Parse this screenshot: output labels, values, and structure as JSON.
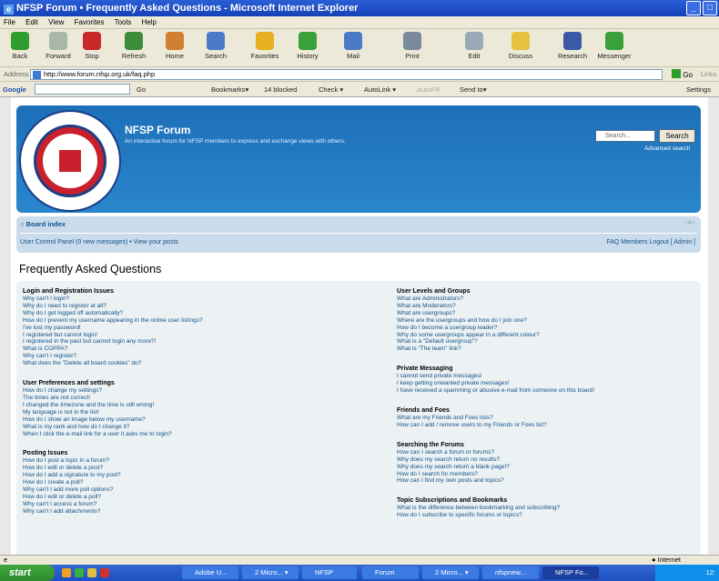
{
  "window": {
    "title": "NFSP Forum • Frequently Asked Questions - Microsoft Internet Explorer"
  },
  "menu": [
    "File",
    "Edit",
    "View",
    "Favorites",
    "Tools",
    "Help"
  ],
  "toolbar": {
    "buttons": [
      {
        "label": "Back",
        "icon": "back-arrow-icon",
        "color": "#2f9d2f"
      },
      {
        "label": "Forward",
        "icon": "forward-arrow-icon",
        "color": "#a8b8a8"
      },
      {
        "label": "Stop",
        "icon": "stop-icon",
        "color": "#c82828"
      },
      {
        "label": "Refresh",
        "icon": "refresh-icon",
        "color": "#3c8c3c"
      },
      {
        "label": "Home",
        "icon": "home-icon",
        "color": "#d08030"
      },
      {
        "label": "Search",
        "icon": "search-icon",
        "color": "#4a7ac8"
      },
      {
        "label": "Favorites",
        "icon": "star-icon",
        "color": "#e8b020"
      },
      {
        "label": "History",
        "icon": "history-icon",
        "color": "#3aa03a"
      },
      {
        "label": "Mail",
        "icon": "mail-icon",
        "color": "#4a7ac8"
      },
      {
        "label": "Print",
        "icon": "print-icon",
        "color": "#7a8a9a"
      },
      {
        "label": "Edit",
        "icon": "edit-icon",
        "color": "#9aa8b8"
      },
      {
        "label": "Discuss",
        "icon": "discuss-icon",
        "color": "#e8c040"
      },
      {
        "label": "Research",
        "icon": "research-icon",
        "color": "#3a5aa8"
      },
      {
        "label": "Messenger",
        "icon": "messenger-icon",
        "color": "#3aa03a"
      }
    ]
  },
  "address": {
    "label": "Address",
    "url": "http://www.forum.nfsp.org.uk/faq.php",
    "go": "Go",
    "links": "Links"
  },
  "googlebar": {
    "label": "Google",
    "items": [
      "Go",
      "Bookmarks▾",
      "14 blocked",
      "Check ▾",
      "AutoLink ▾",
      "AutoFill",
      "Send to▾"
    ],
    "settings": "Settings"
  },
  "forum": {
    "title": "NFSP Forum",
    "description": "An interactive forum for NFSP members to express and exchange views with others.",
    "search_placeholder": "Search...",
    "search_button": "Search",
    "advanced_search": "Advanced search",
    "logo_text": "THE NATIONAL FEDERATION OF SUBPOSTMASTERS",
    "board_index": "Board index",
    "ucp": "User Control Panel (0 new messages) • View your posts",
    "nav_right": "FAQ  Members  Logout [ Admin ]",
    "page_title": "Frequently Asked Questions"
  },
  "faq_left": [
    {
      "heading": "Login and Registration Issues",
      "items": [
        "Why can't I login?",
        "Why do I need to register at all?",
        "Why do I get logged off automatically?",
        "How do I prevent my username appearing in the online user listings?",
        "I've lost my password!",
        "I registered but cannot login!",
        "I registered in the past but cannot login any more?!",
        "What is COPPA?",
        "Why can't I register?",
        "What does the \"Delete all board cookies\" do?"
      ]
    },
    {
      "heading": "User Preferences and settings",
      "items": [
        "How do I change my settings?",
        "The times are not correct!",
        "I changed the timezone and the time is still wrong!",
        "My language is not in the list!",
        "How do I show an image below my username?",
        "What is my rank and how do I change it?",
        "When I click the e-mail link for a user it asks me to login?"
      ]
    },
    {
      "heading": "Posting Issues",
      "items": [
        "How do I post a topic in a forum?",
        "How do I edit or delete a post?",
        "How do I add a signature to my post?",
        "How do I create a poll?",
        "Why can't I add more poll options?",
        "How do I edit or delete a poll?",
        "Why can't I access a forum?",
        "Why can't I add attachments?"
      ]
    }
  ],
  "faq_right": [
    {
      "heading": "User Levels and Groups",
      "items": [
        "What are Administrators?",
        "What are Moderators?",
        "What are usergroups?",
        "Where are the usergroups and how do I join one?",
        "How do I become a usergroup leader?",
        "Why do some usergroups appear in a different colour?",
        "What is a \"Default usergroup\"?",
        "What is \"The team\" link?"
      ]
    },
    {
      "heading": "Private Messaging",
      "items": [
        "I cannot send private messages!",
        "I keep getting unwanted private messages!",
        "I have received a spamming or abusive e-mail from someone on this board!"
      ]
    },
    {
      "heading": "Friends and Foes",
      "items": [
        "What are my Friends and Foes lists?",
        "How can I add / remove users to my Friends or Foes list?"
      ]
    },
    {
      "heading": "Searching the Forums",
      "items": [
        "How can I search a forum or forums?",
        "Why does my search return no results?",
        "Why does my search return a blank page!?",
        "How do I search for members?",
        "How can I find my own posts and topics?"
      ]
    },
    {
      "heading": "Topic Subscriptions and Bookmarks",
      "items": [
        "What is the difference between bookmarking and subscribing?",
        "How do I subscribe to specific forums or topics?"
      ]
    }
  ],
  "status": {
    "zone": "Internet"
  },
  "taskbar": {
    "start": "start",
    "tasks": [
      "Adobe U...",
      "2 Micro... ▾",
      "NFSP",
      "Forum",
      "2 Micro... ▾",
      "nfspnew...",
      "NFSP Fo..."
    ],
    "clock": "12:"
  }
}
